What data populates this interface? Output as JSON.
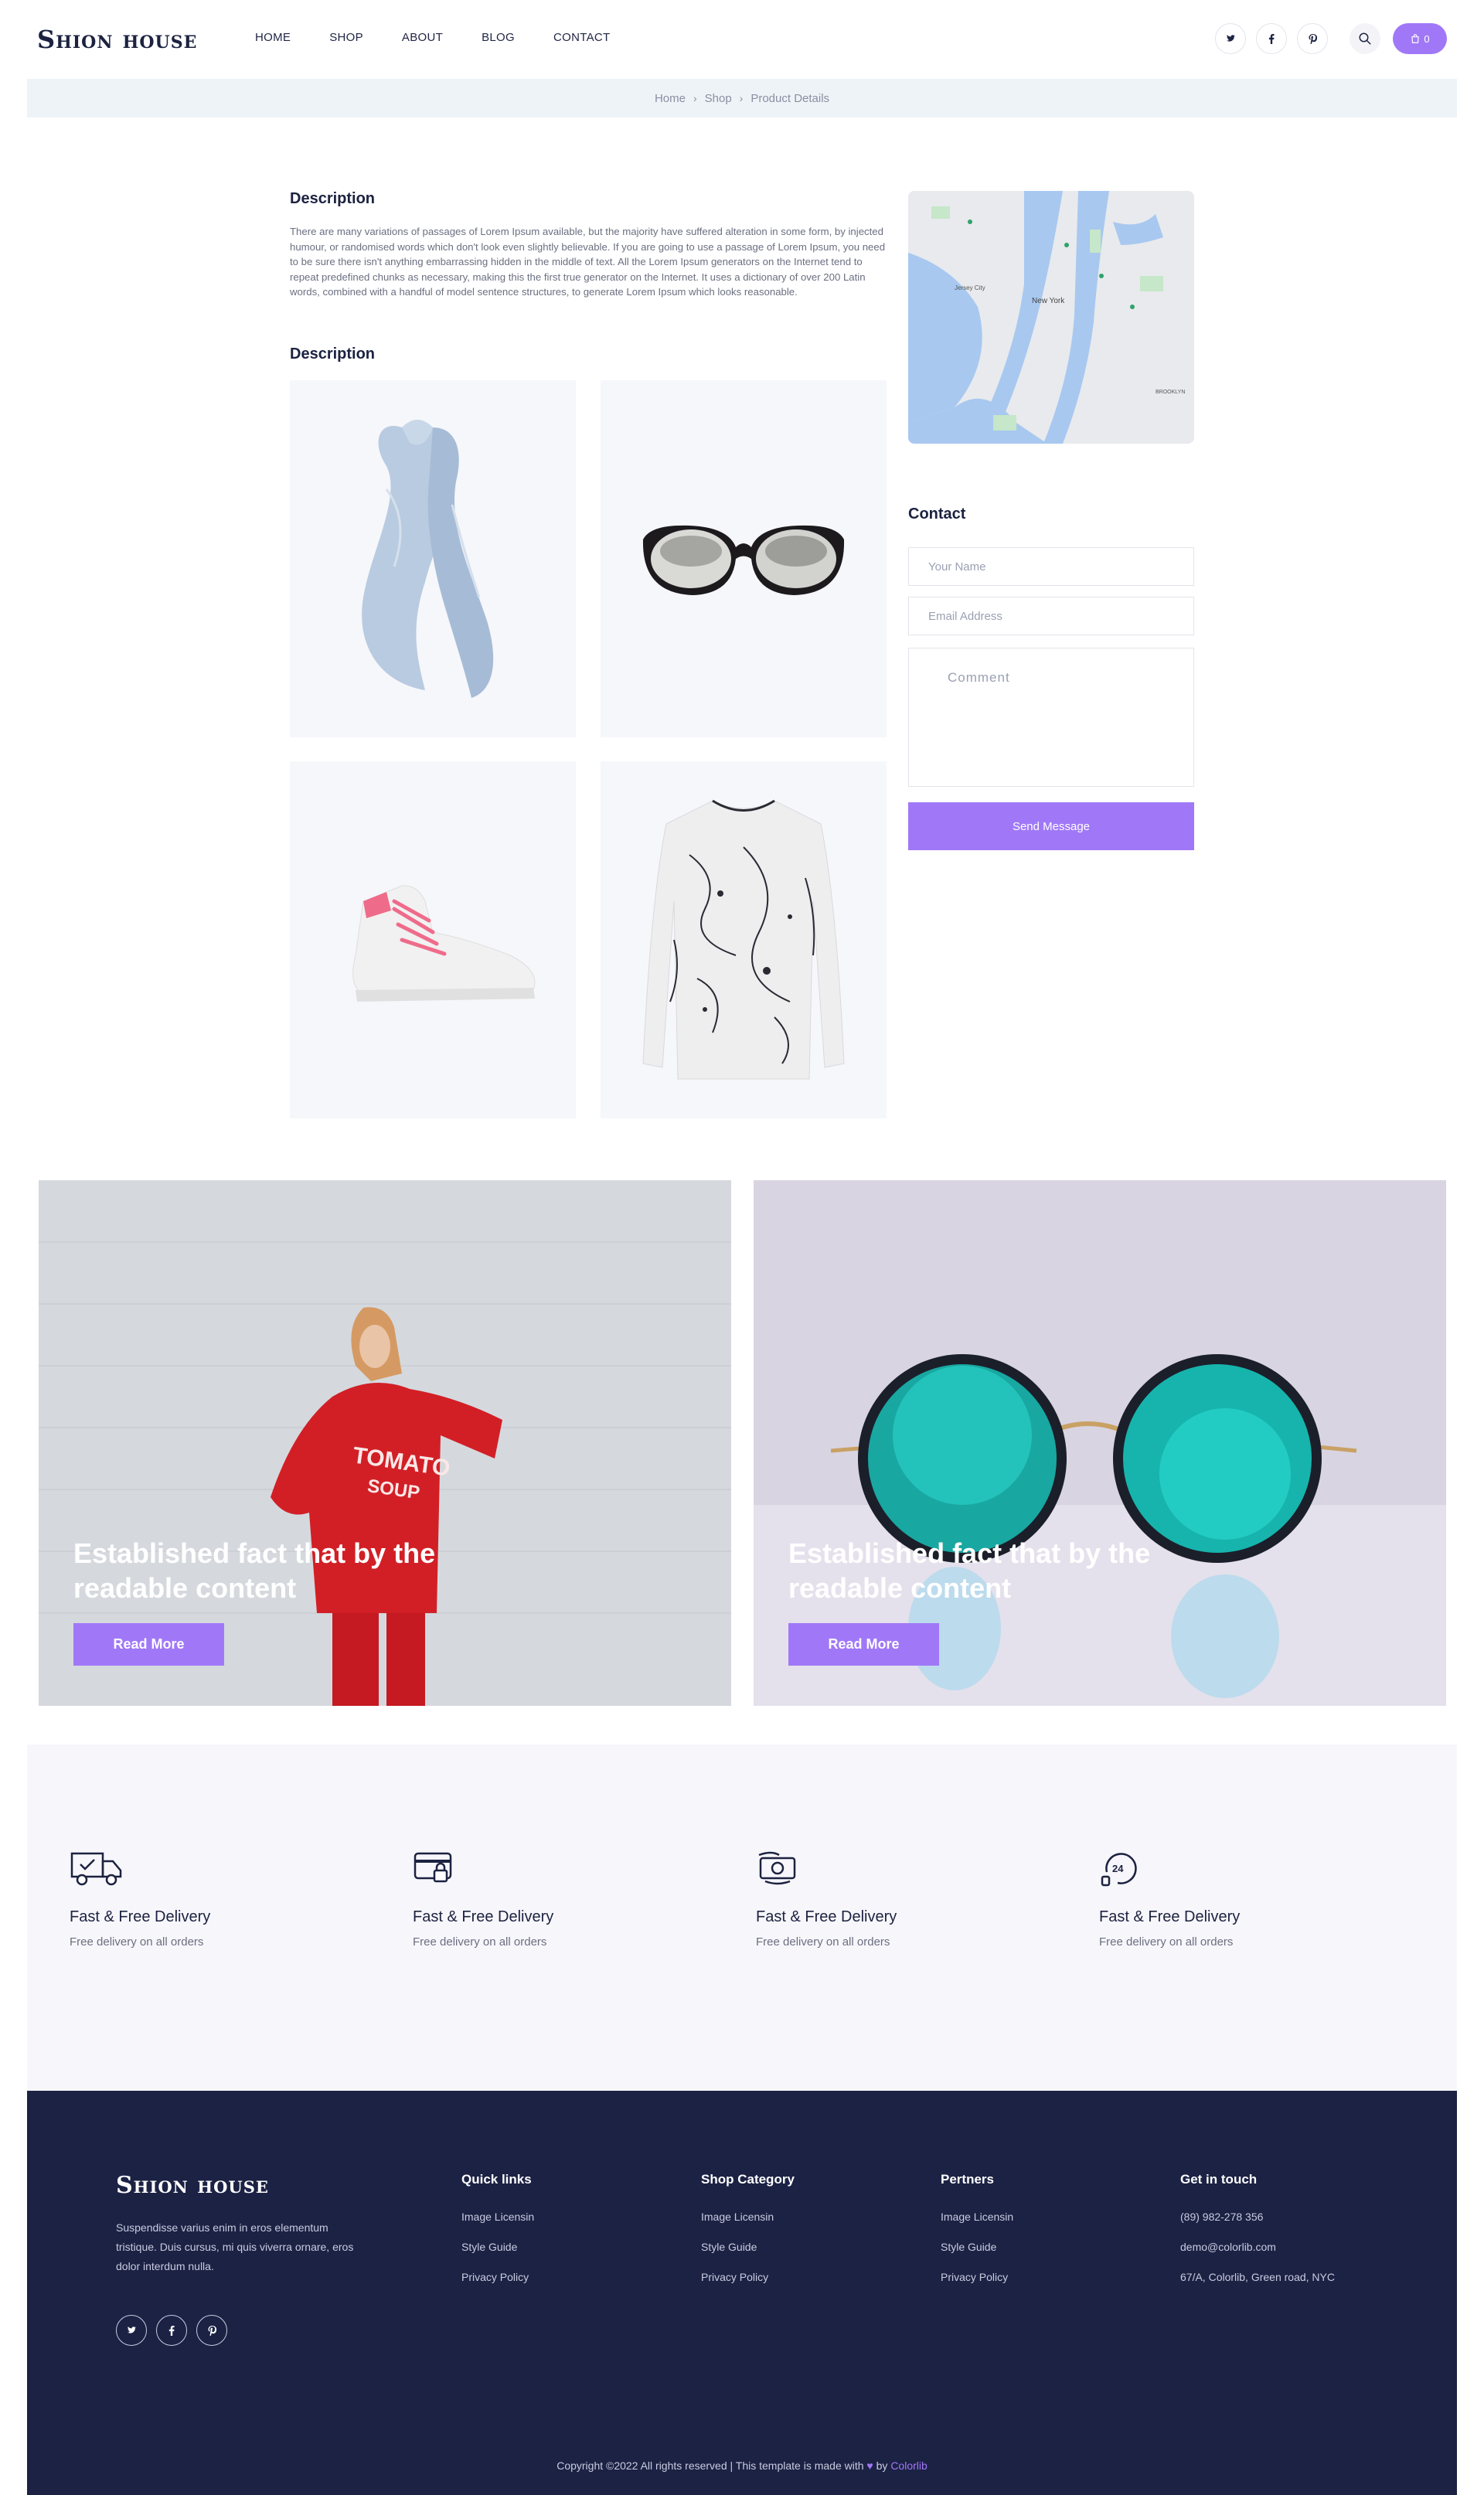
{
  "header": {
    "logo": "Shion house",
    "nav": [
      "HOME",
      "SHOP",
      "ABOUT",
      "BLOG",
      "CONTACT"
    ],
    "social": [
      {
        "icon": "twitter-icon",
        "glyph": "𝕥"
      },
      {
        "icon": "facebook-icon",
        "glyph": "f"
      },
      {
        "icon": "pinterest-icon",
        "glyph": "p"
      }
    ],
    "cart_count": "0"
  },
  "breadcrumb": [
    "Home",
    "Shop",
    "Product Details"
  ],
  "description": {
    "title": "Description",
    "text": "There are many variations of passages of Lorem Ipsum available, but the majority have suffered alteration in some form, by injected humour, or randomised words which don't look even slightly believable. If you are going to use a passage of Lorem Ipsum, you need to be sure there isn't anything embarrassing hidden in the middle of text. All the Lorem Ipsum generators on the Internet tend to repeat predefined chunks as necessary, making this the first true generator on the Internet. It uses a dictionary of over 200 Latin words, combined with a handful of model sentence structures, to generate Lorem Ipsum which looks reasonable.",
    "gallery_title": "Description"
  },
  "contact": {
    "title": "Contact",
    "name_placeholder": "Your Name",
    "email_placeholder": "Email Address",
    "comment_placeholder": "Comment",
    "send_label": "Send Message"
  },
  "map": {
    "labels": [
      "New York",
      "Jersey City",
      "BROOKLYN"
    ]
  },
  "banners": [
    {
      "title": "Established fact that by the readable content",
      "button": "Read More"
    },
    {
      "title": "Established fact that by the readable content",
      "button": "Read More"
    }
  ],
  "features": [
    {
      "icon": "truck-icon",
      "title": "Fast & Free Delivery",
      "subtitle": "Free delivery on all orders"
    },
    {
      "icon": "card-icon",
      "title": "Fast & Free Delivery",
      "subtitle": "Free delivery on all orders"
    },
    {
      "icon": "money-icon",
      "title": "Fast & Free Delivery",
      "subtitle": "Free delivery on all orders"
    },
    {
      "icon": "support-24-icon",
      "title": "Fast & Free Delivery",
      "subtitle": "Free delivery on all orders"
    }
  ],
  "footer": {
    "logo": "Shion house",
    "about": "Suspendisse varius enim in eros elementum tristique. Duis cursus, mi quis viverra ornare, eros dolor interdum nulla.",
    "columns": [
      {
        "title": "Quick links",
        "items": [
          "Image Licensin",
          "Style Guide",
          "Privacy Policy"
        ]
      },
      {
        "title": "Shop Category",
        "items": [
          "Image Licensin",
          "Style Guide",
          "Privacy Policy"
        ]
      },
      {
        "title": "Pertners",
        "items": [
          "Image Licensin",
          "Style Guide",
          "Privacy Policy"
        ]
      },
      {
        "title": "Get in touch",
        "items": [
          "(89) 982-278 356",
          "demo@colorlib.com",
          "67/A, Colorlib, Green road, NYC"
        ]
      }
    ],
    "copyright_prefix": "Copyright ©2022 All rights reserved | This template is made with",
    "copyright_by": "by",
    "copyright_link": "Colorlib"
  },
  "colors": {
    "accent": "#a078f7",
    "navy": "#1c2244",
    "light_bg": "#f7f6fb"
  }
}
